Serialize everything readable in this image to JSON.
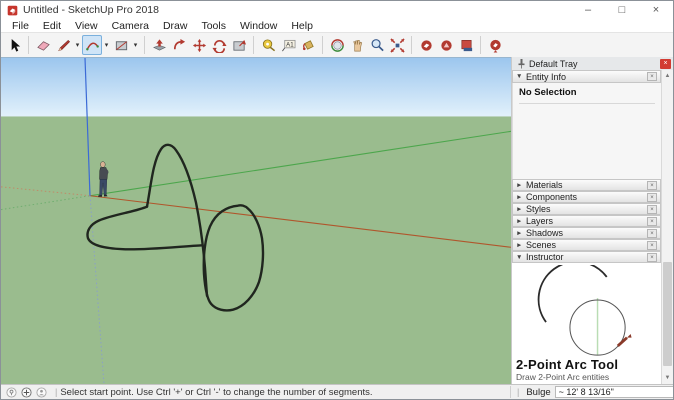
{
  "window": {
    "title": "Untitled - SketchUp Pro 2018",
    "controls": {
      "minimize": "–",
      "maximize": "□",
      "close": "×"
    }
  },
  "menubar": {
    "items": [
      "File",
      "Edit",
      "View",
      "Camera",
      "Draw",
      "Tools",
      "Window",
      "Help"
    ]
  },
  "toolbar": {
    "tools": [
      "select",
      "eraser",
      "line",
      "2-point-arc",
      "rectangle",
      "push-pull",
      "follow-me",
      "move",
      "rotate",
      "offset",
      "tape-measure",
      "text",
      "paint-bucket",
      "orbit",
      "pan",
      "zoom",
      "zoom-extents",
      "3d-warehouse",
      "share-model",
      "send-to-layout",
      "extension-warehouse"
    ],
    "active_tool": "2-point-arc",
    "text_tool_glyph": "A1",
    "dropdown_glyph": "▾"
  },
  "canvas": {
    "sky_top_color": "#9cc6ee",
    "sky_horizon_color": "#e2f1fb",
    "ground_color": "#9abc8e",
    "axis_red": "#b0562c",
    "axis_green": "#4ca64c",
    "axis_blue": "#3b6ad6",
    "sketch_stroke": "#20261f",
    "objects": [
      "person-figure",
      "freehand-arch",
      "freehand-lobe",
      "freehand-ellipse"
    ]
  },
  "tray": {
    "title": "Default Tray",
    "glyphs": {
      "expanded": "▼",
      "collapsed": "►",
      "close_x": "×",
      "up": "▲",
      "down": "▼"
    },
    "entity_info": {
      "label": "Entity Info",
      "status": "No Selection"
    },
    "sections": [
      "Materials",
      "Components",
      "Styles",
      "Layers",
      "Shadows",
      "Scenes"
    ],
    "instructor": {
      "label": "Instructor",
      "tool_title": "2-Point Arc Tool",
      "tool_desc": "Draw 2-Point Arc entities"
    }
  },
  "statusbar": {
    "icons": [
      "geolocation-icon",
      "credits-icon",
      "sign-in-icon"
    ],
    "divider": "|",
    "message": "Select start point. Use Ctrl '+' or Ctrl '-' to change the number of segments.",
    "bulge_label": "Bulge",
    "bulge_value": "~ 12' 8 13/16\""
  }
}
